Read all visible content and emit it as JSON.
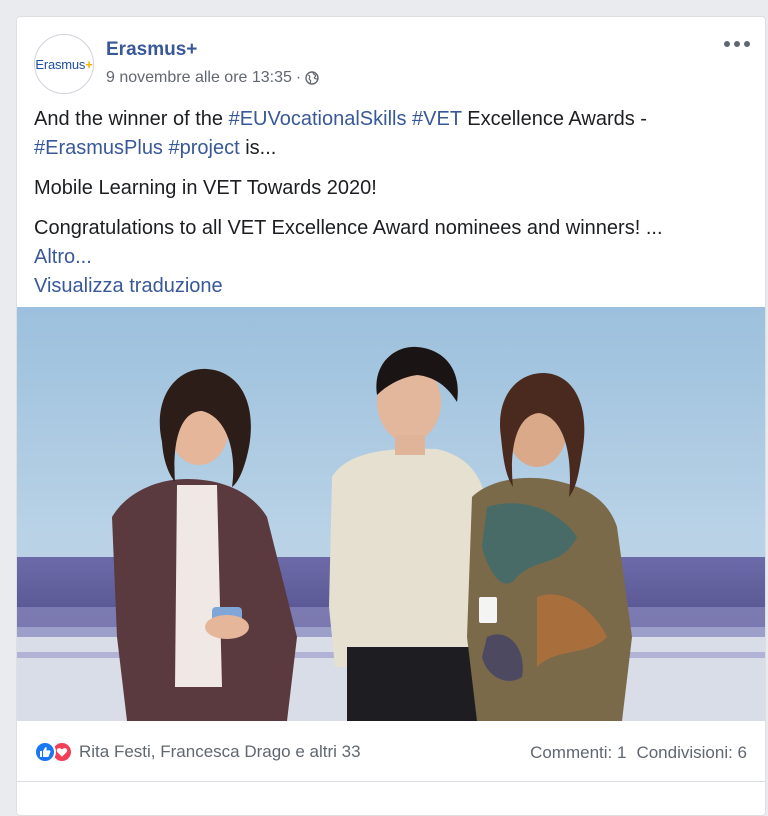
{
  "post": {
    "page_name": "Erasmus+",
    "avatar_text": "Erasmus",
    "avatar_plus": "+",
    "timestamp": "9 novembre alle ore 13:35",
    "separator": "·",
    "privacy_icon": "globe-icon",
    "more_icon": "more-dots-icon"
  },
  "body": {
    "line1_prefix": "And the winner of the ",
    "hashtag1": "#EUVocationalSkills",
    "hashtag2": "#VET",
    "line1_suffix": " Excellence Awards -",
    "hashtag3": "#ErasmusPlus",
    "hashtag4": "#project",
    "line2_suffix": " is...",
    "paragraph2": "Mobile Learning in VET Towards 2020!",
    "paragraph3": "Congratulations to all VET Excellence Award nominees and winners! ...",
    "more_link": "Altro...",
    "translate_link": "Visualizza traduzione"
  },
  "footer": {
    "reaction_icons": [
      "like-icon",
      "love-icon"
    ],
    "reaction_names": "Rita Festi, Francesca Drago e altri 33",
    "comments": "Commenti: 1",
    "shares": "Condivisioni: 6"
  },
  "colors": {
    "link": "#385898",
    "like": "#1877f2",
    "love": "#f33e58",
    "meta": "#616770"
  }
}
